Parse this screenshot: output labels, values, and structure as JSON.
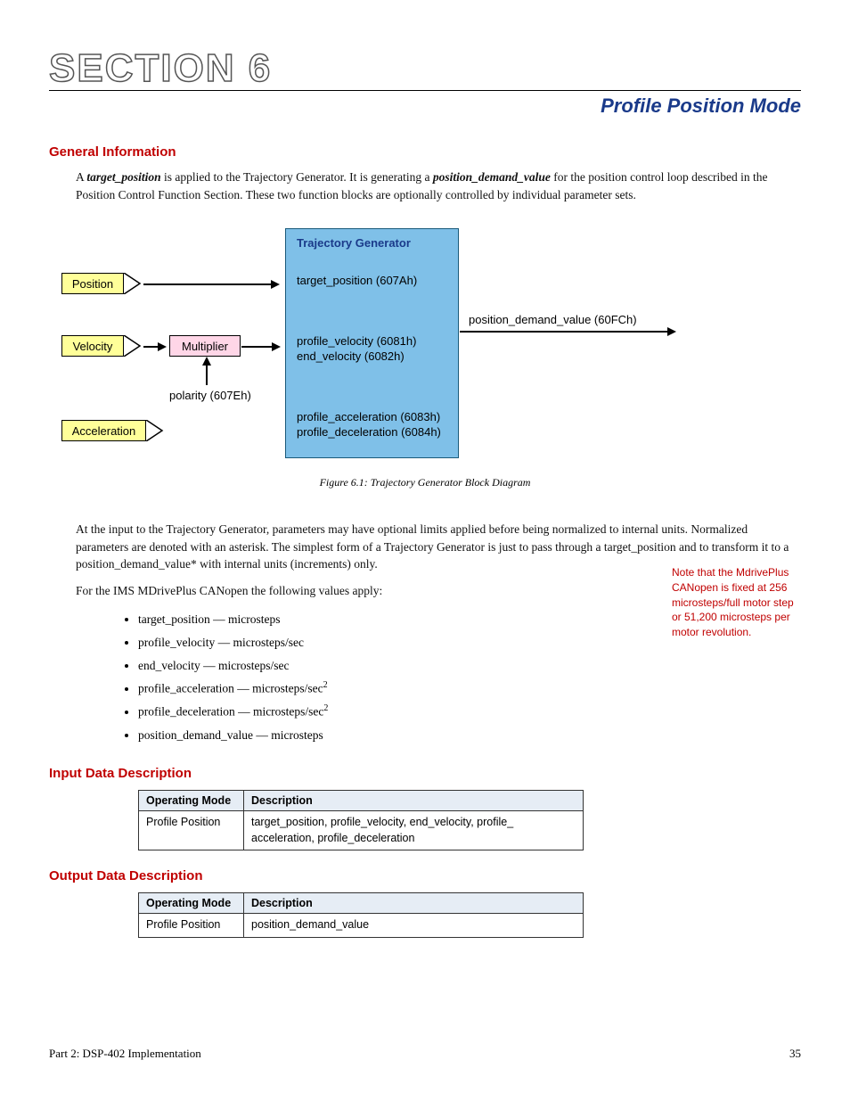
{
  "section_label": "SECTION 6",
  "page_title": "Profile Position Mode",
  "h_general": "General Information",
  "intro_para": "A target_position is applied to the Trajectory Generator. It is generating a position_demand_value for the position control loop described in the Position Control Function Section. These two function blocks are optionally controlled by individual parameter sets.",
  "intro_term1": "target_position",
  "intro_term2": "position_demand_value",
  "diagram": {
    "tg_title": "Trajectory Generator",
    "position": "Position",
    "velocity": "Velocity",
    "multiplier": "Multiplier",
    "acceleration": "Acceleration",
    "polarity": "polarity (607Eh)",
    "row1": "target_position (607Ah)",
    "row2a": "profile_velocity (6081h)",
    "row2b": "end_velocity (6082h)",
    "row3a": "profile_acceleration (6083h)",
    "row3b": "profile_deceleration (6084h)",
    "output": "position_demand_value (60FCh)"
  },
  "figure_caption": "Figure 6.1: Trajectory Generator Block Diagram",
  "para2": "At the input to the Trajectory Generator, parameters may have optional limits applied before being normalized to internal units. Normalized parameters are denoted with an asterisk. The simplest form of a Trajectory Generator is just to pass through a target_position and to transform it to a position_demand_value* with internal units (increments) only.",
  "para3": "For the IMS MDrivePlus CANopen the following values apply:",
  "sidebar": "Note that the MdrivePlus CANopen is fixed at 256 microsteps/full motor step or 51,200 microsteps per motor revolution.",
  "units": {
    "u1": "target_position — microsteps",
    "u2": "profile_velocity — microsteps/sec",
    "u3": "end_velocity — microsteps/sec",
    "u4": "profile_acceleration — microsteps/sec",
    "u5": "profile_deceleration — microsteps/sec",
    "u6": "position_demand_value — microsteps",
    "sup": "2"
  },
  "h_input": "Input Data Description",
  "h_output": "Output Data Description",
  "table_headers": {
    "c1": "Operating Mode",
    "c2": "Description"
  },
  "input_row": {
    "c1": "Profile Position",
    "c2": "target_position, profile_velocity, end_velocity, profile_ acceleration, profile_deceleration"
  },
  "output_row": {
    "c1": "Profile Position",
    "c2": "position_demand_value"
  },
  "footer_left": "Part 2: DSP-402 Implementation",
  "footer_right": "35"
}
